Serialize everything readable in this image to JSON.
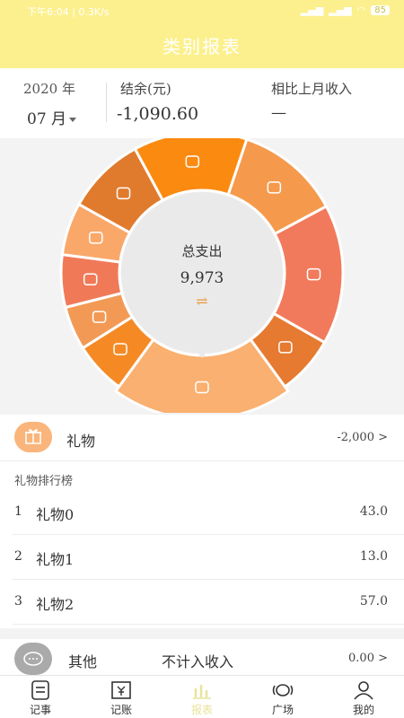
{
  "status_bar": {
    "left": "下午6:04 | 0.3K/s",
    "battery": "85"
  },
  "header": {
    "title": "类别报表"
  },
  "summary": {
    "year": "2020 年",
    "month": "07 月",
    "balance_label": "结余(元)",
    "balance_value": "-1,090.60",
    "compare_label": "相比上月收入",
    "compare_value": "—"
  },
  "chart": {
    "center_label": "总支出",
    "center_value": "9,973",
    "center_switch": "⇌"
  },
  "chart_data": {
    "type": "pie",
    "title": "总支出",
    "total": 9973,
    "series": [
      {
        "icon": "gift-icon",
        "color": "#f9b070"
      },
      {
        "icon": "bag-icon",
        "color": "#f58a25"
      },
      {
        "icon": "house-icon",
        "color": "#f29a55"
      },
      {
        "icon": "heart-icon",
        "color": "#f07a58"
      },
      {
        "icon": "stethoscope-icon",
        "color": "#f9a86a"
      },
      {
        "icon": "sofa-icon",
        "color": "#e07b2e"
      },
      {
        "icon": "shopping-icon",
        "color": "#fb8a10"
      },
      {
        "icon": "box-icon",
        "color": "#f59a4d"
      },
      {
        "icon": "baby-icon",
        "color": "#f27a5c"
      },
      {
        "icon": "chat-icon",
        "color": "#e57a30"
      }
    ],
    "values": [
      2000,
      600,
      500,
      600,
      600,
      900,
      1300,
      1200,
      1600,
      673
    ]
  },
  "selected_category": {
    "name": "礼物",
    "amount": "-2,000 >",
    "color": "#f9b57b"
  },
  "ranking": {
    "title": "礼物排行榜",
    "rows": [
      {
        "no": "1",
        "name": "礼物0",
        "value": "43.0"
      },
      {
        "no": "2",
        "name": "礼物1",
        "value": "13.0"
      },
      {
        "no": "3",
        "name": "礼物2",
        "value": "57.0"
      }
    ]
  },
  "other_row": {
    "name": "其他",
    "note": "不计入收入",
    "amount": "0.00 >"
  },
  "tabbar": {
    "tabs": [
      {
        "label": "记事",
        "icon": "note-icon"
      },
      {
        "label": "记账",
        "icon": "ledger-icon"
      },
      {
        "label": "报表",
        "icon": "chart-icon"
      },
      {
        "label": "广场",
        "icon": "plaza-icon"
      },
      {
        "label": "我的",
        "icon": "user-icon"
      }
    ]
  }
}
